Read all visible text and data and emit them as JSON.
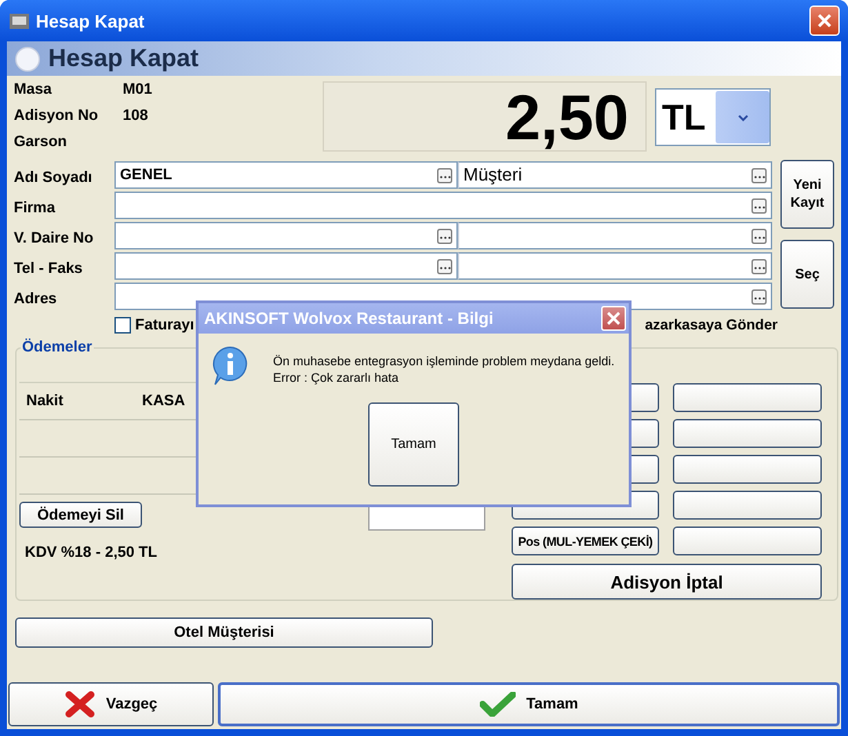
{
  "window": {
    "title": "Hesap Kapat"
  },
  "header": {
    "title": "Hesap Kapat"
  },
  "info": [
    {
      "label": "Masa",
      "value": "M01"
    },
    {
      "label": "Adisyon No",
      "value": "108"
    },
    {
      "label": "Garson"
    }
  ],
  "amount": "2,50",
  "currency": {
    "value": "TL"
  },
  "form": [
    {
      "label": "Adı Soyadı",
      "fields": [
        {
          "kind": "lookup",
          "value": "GENEL"
        },
        {
          "kind": "lookup",
          "value": "Müşteri"
        }
      ]
    },
    {
      "label": "Firma",
      "fields": [
        {
          "kind": "lookup"
        }
      ]
    },
    {
      "label": "V. Daire No",
      "fields": [
        {
          "kind": "lookup"
        },
        {
          "kind": "lookup"
        }
      ]
    },
    {
      "label": "Tel - Faks",
      "fields": [
        {
          "kind": "lookup"
        },
        {
          "kind": "lookup"
        }
      ]
    },
    {
      "label": "Adres",
      "fields": [
        {
          "kind": "lookup"
        }
      ]
    }
  ],
  "side_buttons": [
    "Yeni Kayıt",
    "Seç"
  ],
  "invoice_checkbox": {
    "label": "Faturayı",
    "checked": false
  },
  "register_label": "azarkasaya Gönder",
  "payments": {
    "title": "Ödemeler",
    "rows": [
      {
        "kind": "entry",
        "method": "Nakit",
        "account": "KASA"
      },
      {
        "kind": "blank"
      },
      {
        "kind": "blank"
      }
    ],
    "delete_button": "Ödemeyi Sil",
    "tax_text": "KDV %18 - 2,50 TL",
    "method_buttons": [
      {
        "kind": "blank"
      },
      {
        "kind": "blank"
      },
      {
        "kind": "blank"
      },
      {
        "kind": "blank"
      },
      {
        "kind": "blank"
      },
      {
        "kind": "blank"
      },
      {
        "kind": "blank"
      },
      {
        "kind": "blank"
      },
      {
        "kind": "labeled",
        "label": "Pos (MUL-YEMEK ÇEKİ)"
      },
      {
        "kind": "blank"
      }
    ],
    "cancel_bill_button": "Adisyon İptal"
  },
  "hotel_button": "Otel Müşterisi",
  "footer": [
    {
      "kind": "cancel",
      "label": "Vazgeç"
    },
    {
      "kind": "ok",
      "label": "Tamam"
    }
  ],
  "dialog": {
    "title": "AKINSOFT Wolvox Restaurant - Bilgi",
    "message": "Ön muhasebe entegrasyon işleminde problem meydana geldi.\nError : Çok zararlı hata",
    "button": "Tamam"
  }
}
